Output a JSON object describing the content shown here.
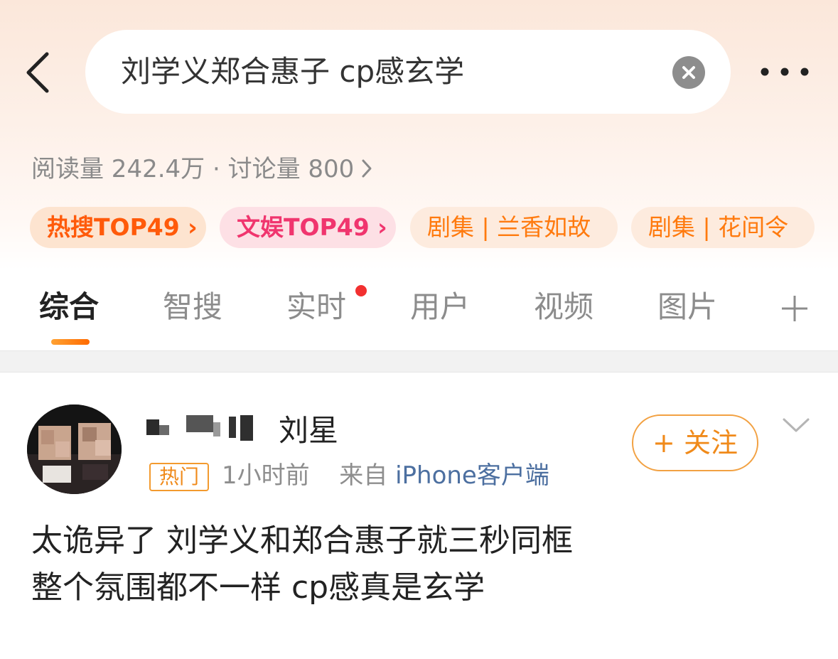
{
  "search": {
    "query": "刘学义郑合惠子 cp感玄学"
  },
  "topic_stats": {
    "text": "阅读量 242.4万 · 讨论量 800"
  },
  "tags": [
    {
      "label": "热搜TOP49 ›"
    },
    {
      "label": "文娱TOP49 ›"
    },
    {
      "label": "剧集 | 兰香如故"
    },
    {
      "label": "剧集 | 花间令"
    }
  ],
  "tabs": [
    {
      "label": "综合",
      "active": true
    },
    {
      "label": "智搜"
    },
    {
      "label": "实时",
      "has_notification_dot": true
    },
    {
      "label": "用户"
    },
    {
      "label": "视频"
    },
    {
      "label": "图片"
    }
  ],
  "post": {
    "username_visible": "刘星",
    "badge": "热门",
    "time": "1小时前",
    "source_prefix": "来自",
    "source": "iPhone客户端",
    "follow_label": "+ 关注",
    "body_lines": [
      "太诡异了 刘学义和郑合惠子就三秒同框",
      "整个氛围都不一样 cp感真是玄学"
    ]
  },
  "colors": {
    "accent_orange": "#ff7a0e",
    "hot_red_orange": "#ff5a0a",
    "ent_pink": "#f0356e",
    "notification_dot": "#f23030",
    "source_blue": "#4c6fa0"
  },
  "icons": [
    "back-chevron-icon",
    "clear-icon",
    "more-icon",
    "chevron-right-icon",
    "add-tab-icon",
    "chevron-down-icon"
  ]
}
